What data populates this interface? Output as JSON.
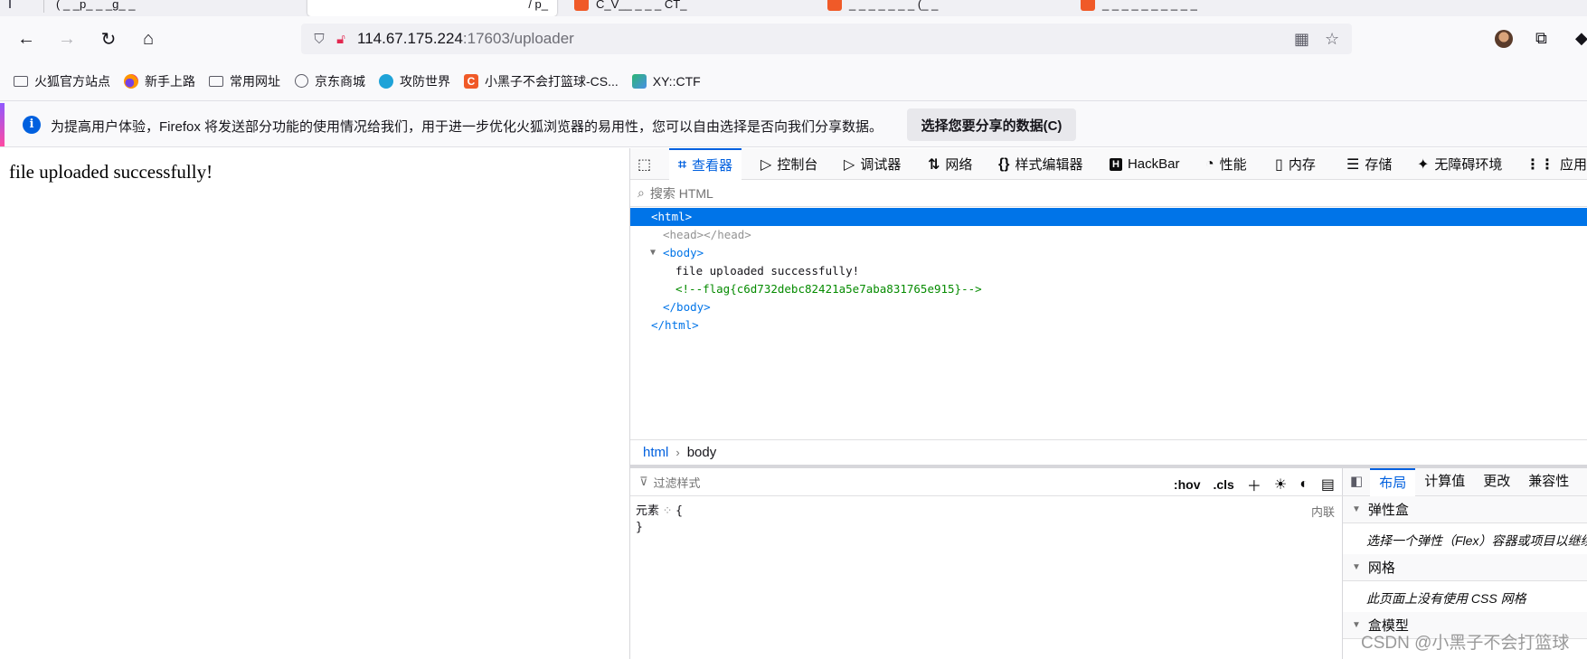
{
  "tabs": [
    {
      "title": "( _ _p_ _ _g_ _"
    },
    {
      "title": "/ p_"
    },
    {
      "title": "C_V__ _ _ _ CT_"
    },
    {
      "title": "_ _ _ _ _ _ _ (_ _"
    },
    {
      "title": "_ _ _ _ _ _ _ _ _ _"
    }
  ],
  "navbar": {
    "url_host": "114.67.175.224",
    "url_rest": ":17603/uploader"
  },
  "bookmarks": [
    {
      "label": "火狐官方站点",
      "icon": "folder-icon"
    },
    {
      "label": "新手上路",
      "icon": "firefox-icon"
    },
    {
      "label": "常用网址",
      "icon": "folder-icon"
    },
    {
      "label": "京东商城",
      "icon": "globe-icon"
    },
    {
      "label": "攻防世界",
      "icon": "site-icon"
    },
    {
      "label": "小黑子不会打篮球-CS...",
      "icon": "csdn-icon"
    },
    {
      "label": "XY::CTF",
      "icon": "xyctf-icon"
    }
  ],
  "notification": {
    "message": "为提高用户体验，Firefox 将发送部分功能的使用情况给我们，用于进一步优化火狐浏览器的易用性，您可以自由选择是否向我们分享数据。",
    "button": "选择您要分享的数据(C)"
  },
  "page": {
    "text": "file uploaded successfully!"
  },
  "devtools": {
    "tabs": [
      "查看器",
      "控制台",
      "调试器",
      "网络",
      "样式编辑器",
      "HackBar",
      "性能",
      "内存",
      "存储",
      "无障碍环境",
      "应用程"
    ],
    "search_placeholder": "搜索 HTML",
    "tree": {
      "html_open": "<html>",
      "head": "<head></head>",
      "body_open": "<body>",
      "text": "file uploaded successfully!",
      "comment": "<!--flag{c6d732debc82421a5e7aba831765e915}-->",
      "body_close": "</body>",
      "html_close": "</html>"
    },
    "breadcrumbs": [
      "html",
      "body"
    ],
    "rules": {
      "filter_placeholder": "过滤样式",
      "hov": ":hov",
      "cls": ".cls",
      "selector": "元素",
      "open_brace": "{",
      "close_brace": "}",
      "inline": "内联"
    },
    "sidebar": {
      "tabs": [
        "布局",
        "计算值",
        "更改",
        "兼容性"
      ],
      "sections": [
        {
          "title": "弹性盒",
          "body": "选择一个弹性（Flex）容器或项目以继续。"
        },
        {
          "title": "网格",
          "body": "此页面上没有使用 CSS 网格"
        },
        {
          "title": "盒模型",
          "body": ""
        }
      ]
    }
  },
  "watermark": "CSDN @小黑子不会打篮球"
}
